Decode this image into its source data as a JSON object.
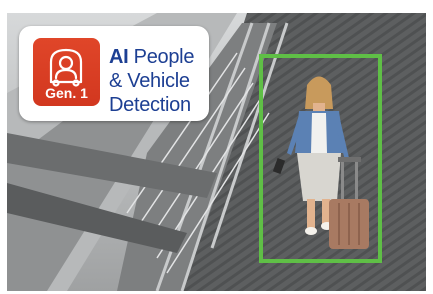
{
  "badge": {
    "generation": "Gen. 1",
    "title_emphasis": "AI",
    "title_line1": " People",
    "title_line2": "& Vehicle",
    "title_line3": "Detection",
    "icon": "person-in-vehicle-icon"
  },
  "detection": {
    "label": "person",
    "color": "#5fbf46"
  },
  "colors": {
    "title": "#1d3f93",
    "badge_red": "#d8391f",
    "box_green": "#5fbf46"
  }
}
